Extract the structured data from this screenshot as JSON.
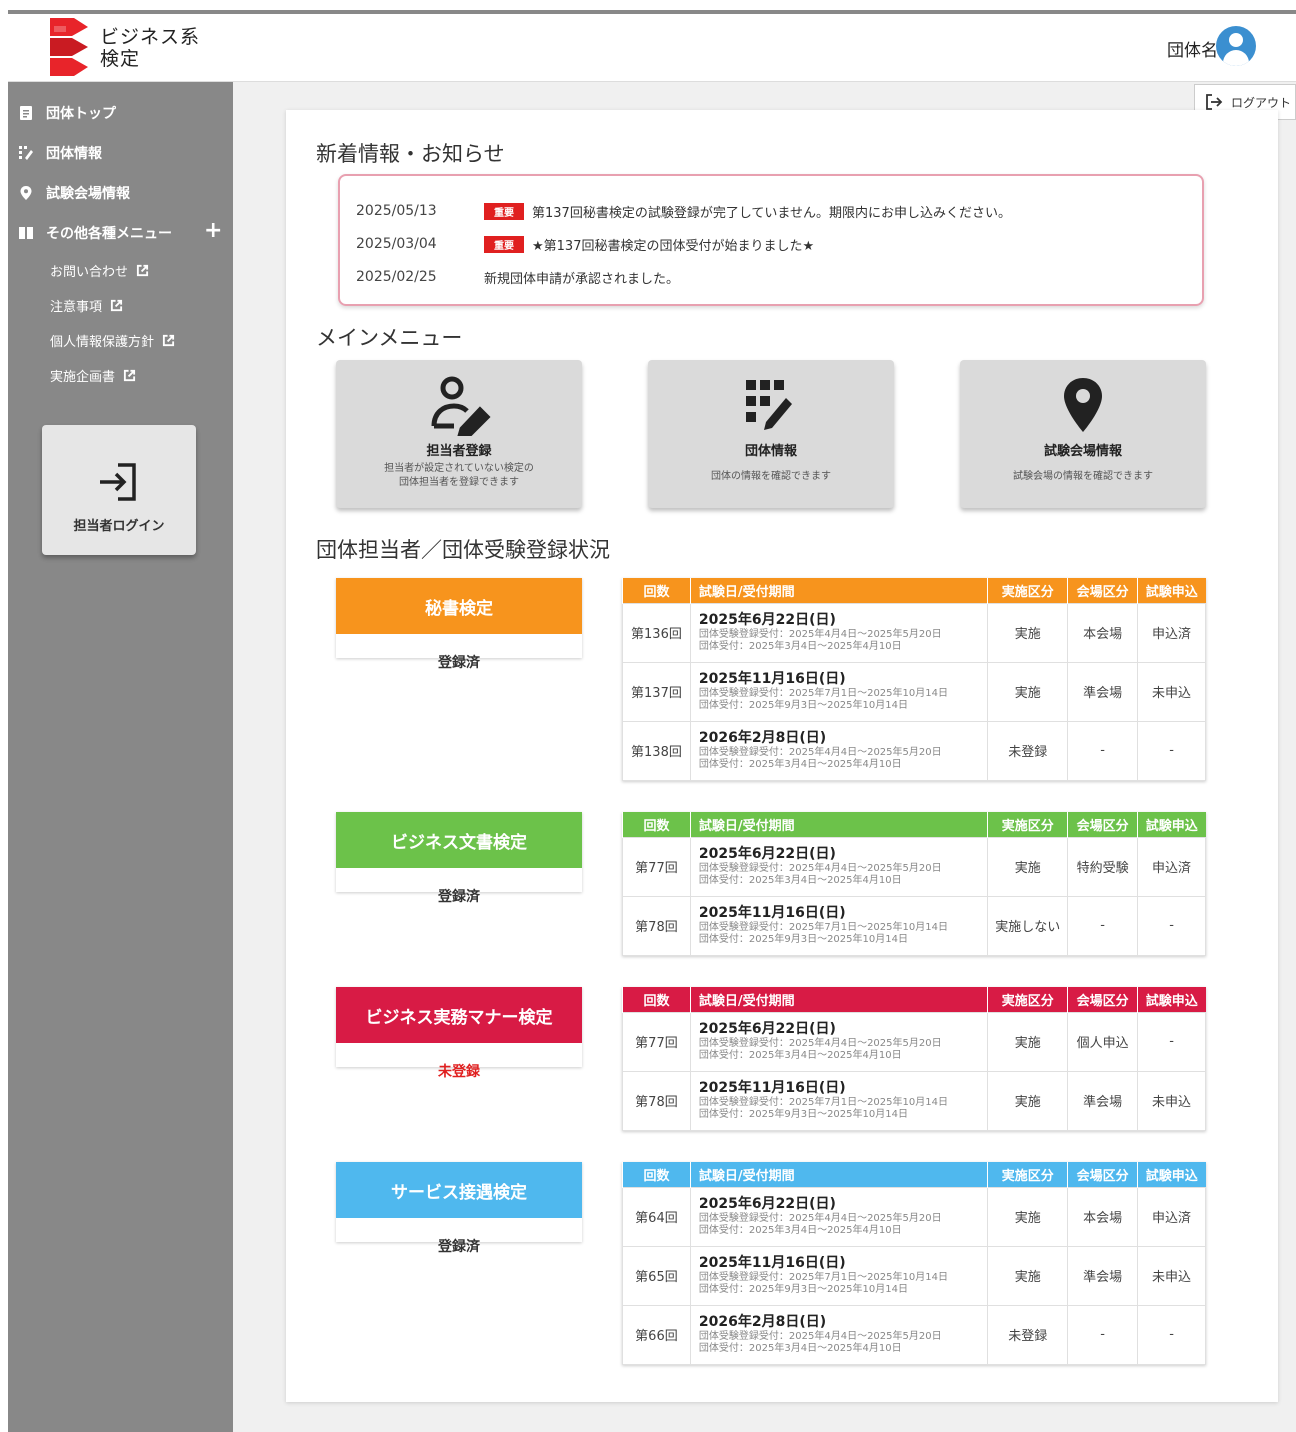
{
  "header": {
    "logo_line1": "ビジネス系",
    "logo_line2": "検定",
    "org_name": "団体名",
    "logout_label": "ログアウト"
  },
  "sidebar": {
    "items": [
      {
        "label": "団体トップ",
        "icon": "document-icon"
      },
      {
        "label": "団体情報",
        "icon": "grid-edit-icon"
      },
      {
        "label": "試験会場情報",
        "icon": "map-pin-icon"
      },
      {
        "label": "その他各種メニュー",
        "icon": "book-icon"
      }
    ],
    "sub_items": [
      {
        "label": "お問い合わせ"
      },
      {
        "label": "注意事項"
      },
      {
        "label": "個人情報保護方針"
      },
      {
        "label": "実施企画書"
      }
    ],
    "login_label": "担当者ログイン"
  },
  "news": {
    "title": "新着情報・お知らせ",
    "items": [
      {
        "date": "2025/05/13",
        "badge": "重要",
        "text": "第137回秘書検定の試験登録が完了していません。期限内にお申し込みください。"
      },
      {
        "date": "2025/03/04",
        "badge": "重要",
        "text": "★第137回秘書検定の団体受付が始まりました★"
      },
      {
        "date": "2025/02/25",
        "badge": "",
        "text": "新規団体申請が承認されました。"
      }
    ]
  },
  "main_menu": {
    "title": "メインメニュー",
    "cards": [
      {
        "title": "担当者登録",
        "desc": "担当者が設定されていない検定の\n団体担当者を登録できます"
      },
      {
        "title": "団体情報",
        "desc": "団体の情報を確認できます"
      },
      {
        "title": "試験会場情報",
        "desc": "試験会場の情報を確認できます"
      }
    ]
  },
  "status_section": {
    "title": "団体担当者／団体受験登録状況",
    "headers": [
      "回数",
      "試験日/受付期間",
      "実施区分",
      "会場区分",
      "試験申込"
    ],
    "exams": [
      {
        "name": "秘書検定",
        "status": "登録済",
        "color": "#f7941d",
        "status_color": "#333333",
        "rows": [
          {
            "round": "第136回",
            "date": "2025年6月22日(日)",
            "sub1": "団体受験登録受付：2025年4月4日～2025年5月20日",
            "sub2": "団体受付：2025年3月4日～2025年4月10日",
            "impl": "実施",
            "venue": "本会場",
            "apply": "申込済"
          },
          {
            "round": "第137回",
            "date": "2025年11月16日(日)",
            "sub1": "団体受験登録受付：2025年7月1日～2025年10月14日",
            "sub2": "団体受付：2025年9月3日～2025年10月14日",
            "impl": "実施",
            "venue": "準会場",
            "apply": "未申込"
          },
          {
            "round": "第138回",
            "date": "2026年2月8日(日)",
            "sub1": "団体受験登録受付：2025年4月4日～2025年5月20日",
            "sub2": "団体受付：2025年3月4日～2025年4月10日",
            "impl": "未登録",
            "venue": "-",
            "apply": "-"
          }
        ]
      },
      {
        "name": "ビジネス文書検定",
        "status": "登録済",
        "color": "#6cc24a",
        "status_color": "#333333",
        "rows": [
          {
            "round": "第77回",
            "date": "2025年6月22日(日)",
            "sub1": "団体受験登録受付：2025年4月4日～2025年5月20日",
            "sub2": "団体受付：2025年3月4日～2025年4月10日",
            "impl": "実施",
            "venue": "特約受験",
            "apply": "申込済"
          },
          {
            "round": "第78回",
            "date": "2025年11月16日(日)",
            "sub1": "団体受験登録受付：2025年7月1日～2025年10月14日",
            "sub2": "団体受付：2025年9月3日～2025年10月14日",
            "impl": "実施しない",
            "venue": "-",
            "apply": "-"
          }
        ]
      },
      {
        "name": "ビジネス実務マナー検定",
        "status": "未登録",
        "color": "#d81b45",
        "status_color": "#e02020",
        "rows": [
          {
            "round": "第77回",
            "date": "2025年6月22日(日)",
            "sub1": "団体受験登録受付：2025年4月4日～2025年5月20日",
            "sub2": "団体受付：2025年3月4日～2025年4月10日",
            "impl": "実施",
            "venue": "個人申込",
            "apply": "-"
          },
          {
            "round": "第78回",
            "date": "2025年11月16日(日)",
            "sub1": "団体受験登録受付：2025年7月1日～2025年10月14日",
            "sub2": "団体受付：2025年9月3日～2025年10月14日",
            "impl": "実施",
            "venue": "準会場",
            "apply": "未申込"
          }
        ]
      },
      {
        "name": "サービス接遇検定",
        "status": "登録済",
        "color": "#4fb8ee",
        "status_color": "#333333",
        "rows": [
          {
            "round": "第64回",
            "date": "2025年6月22日(日)",
            "sub1": "団体受験登録受付：2025年4月4日～2025年5月20日",
            "sub2": "団体受付：2025年3月4日～2025年4月10日",
            "impl": "実施",
            "venue": "本会場",
            "apply": "申込済"
          },
          {
            "round": "第65回",
            "date": "2025年11月16日(日)",
            "sub1": "団体受験登録受付：2025年7月1日～2025年10月14日",
            "sub2": "団体受付：2025年9月3日～2025年10月14日",
            "impl": "実施",
            "venue": "準会場",
            "apply": "未申込"
          },
          {
            "round": "第66回",
            "date": "2026年2月8日(日)",
            "sub1": "団体受験登録受付：2025年4月4日～2025年5月20日",
            "sub2": "団体受付：2025年3月4日～2025年4月10日",
            "impl": "未登録",
            "venue": "-",
            "apply": "-"
          }
        ]
      }
    ]
  }
}
